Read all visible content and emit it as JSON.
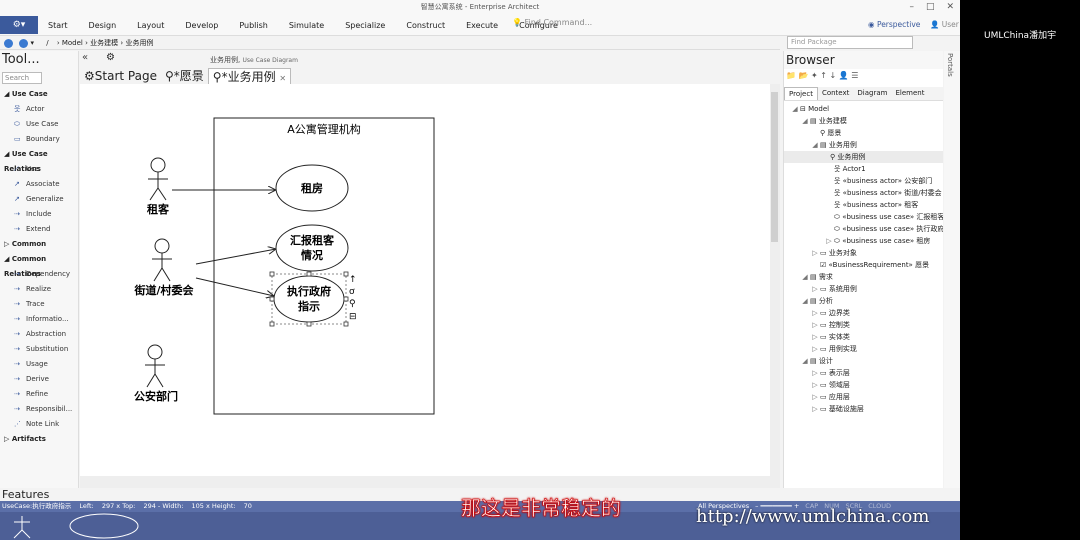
{
  "window": {
    "title": "智慧公寓系统 - Enterprise Architect"
  },
  "ribbon": {
    "menu": [
      "Start",
      "Design",
      "Layout",
      "Develop",
      "Publish",
      "Simulate",
      "Specialize",
      "Construct",
      "Execute",
      "Configure"
    ],
    "find_command": "Find Command...",
    "perspective": "Perspective",
    "user": "User"
  },
  "nav": {
    "path_root": "/",
    "path": [
      "Model",
      "业务建模",
      "业务用例"
    ],
    "find_package_placeholder": "Find Package"
  },
  "toolbox": {
    "title": "Tool...",
    "search_placeholder": "Search",
    "sections": [
      {
        "title": "Use Case",
        "items": [
          "Actor",
          "Use Case",
          "Boundary"
        ]
      },
      {
        "title": "Use Case Relations",
        "items": [
          "Use",
          "Associate",
          "Generalize",
          "Include",
          "Extend"
        ]
      },
      {
        "title": "Common",
        "items": []
      },
      {
        "title": "Common Relations",
        "items": [
          "Dependency",
          "Realize",
          "Trace",
          "Informatio...",
          "Abstraction",
          "Substitution",
          "Usage",
          "Derive",
          "Refine",
          "Responsibil...",
          "Note Link"
        ]
      },
      {
        "title": "Artifacts",
        "items": []
      }
    ]
  },
  "diagram_header": {
    "name": "业务用例,",
    "type": "Use Case Diagram"
  },
  "tabs": [
    "Start Page",
    "*愿景",
    "*业务用例"
  ],
  "diagram": {
    "boundary_title": "A公寓管理机构",
    "actors": [
      "租客",
      "街道/村委会",
      "公安部门"
    ],
    "usecases": [
      "租房",
      "汇报租客情况",
      "执行政府指示"
    ],
    "usecase_lines": [
      [
        "汇报租客",
        "情况"
      ],
      [
        "执行政府",
        "指示"
      ]
    ]
  },
  "browser": {
    "title": "Browser",
    "tabs": [
      "Project",
      "Context",
      "Diagram",
      "Element"
    ],
    "tree": [
      {
        "label": "Model"
      },
      {
        "label": "业务建模"
      },
      {
        "label": "愿景"
      },
      {
        "label": "业务用例"
      },
      {
        "label": "业务用例"
      },
      {
        "label": "Actor1"
      },
      {
        "label": "«business actor» 公安部门"
      },
      {
        "label": "«business actor» 街道/村委会"
      },
      {
        "label": "«business actor» 租客"
      },
      {
        "label": "«business use case» 汇报租客情况"
      },
      {
        "label": "«business use case» 执行政府指示"
      },
      {
        "label": "«business use case» 租房"
      },
      {
        "label": "业务对象"
      },
      {
        "label": "«BusinessRequirement» 愿景"
      },
      {
        "label": "需求"
      },
      {
        "label": "系统用例"
      },
      {
        "label": "分析"
      },
      {
        "label": "边界类"
      },
      {
        "label": "控制类"
      },
      {
        "label": "实体类"
      },
      {
        "label": "用例实现"
      },
      {
        "label": "设计"
      },
      {
        "label": "表示层"
      },
      {
        "label": "领域层"
      },
      {
        "label": "应用层"
      },
      {
        "label": "基础设施层"
      }
    ]
  },
  "portals_label": "Portals",
  "features_label": "Features",
  "status": {
    "selection": "UseCase:执行政府指示",
    "left": "Left:",
    "left_val": "297 x Top:",
    "top_val": "294 - Width:",
    "width_val": "105 x Height:",
    "height_val": "70",
    "perspectives": "All Perspectives",
    "flags": [
      "CAP",
      "NUM",
      "SCRL",
      "CLOUD"
    ]
  },
  "presenter": "UMLChina潘加宇",
  "subtitle": "那这是非常稳定的",
  "watermark": "http://www.umlchina.com",
  "colors": {
    "ribbon_accent": "#3b5a9c",
    "status_bar": "#5b6fa8",
    "subtitle_stroke": "#cc0000"
  }
}
